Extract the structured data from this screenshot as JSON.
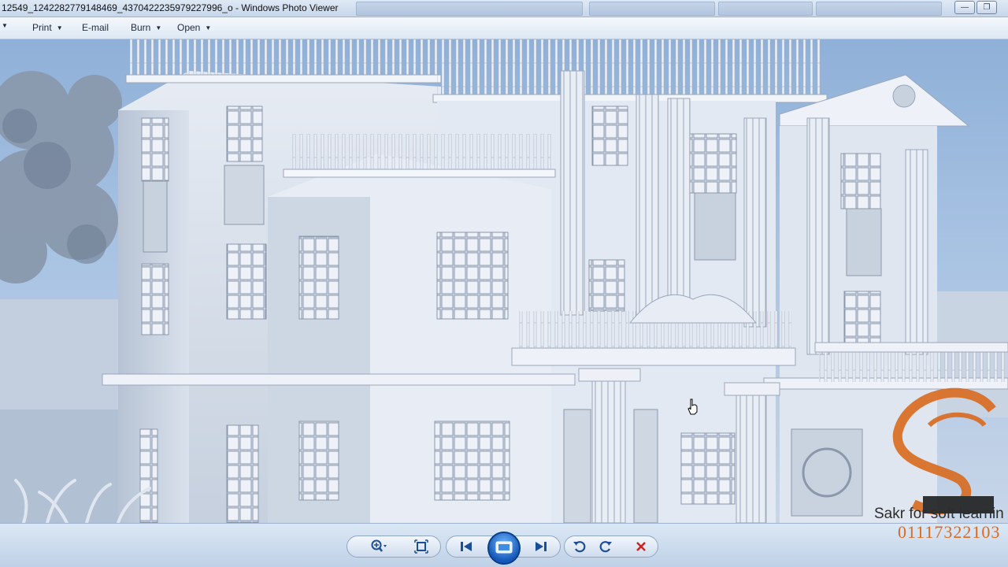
{
  "window": {
    "title": "12549_1242282779148469_4370422235979227996_o - Windows Photo Viewer",
    "controls": [
      "minimize",
      "restore"
    ]
  },
  "menu": {
    "items": [
      {
        "label": "Print",
        "has_dropdown": true
      },
      {
        "label": "E-mail",
        "has_dropdown": false
      },
      {
        "label": "Burn",
        "has_dropdown": true
      },
      {
        "label": "Open",
        "has_dropdown": true
      }
    ]
  },
  "photo": {
    "subject": "classical villa facade 3D render"
  },
  "controls": {
    "buttons": [
      "zoom-icon",
      "actual-size-icon",
      "previous-icon",
      "slideshow-icon",
      "next-icon",
      "rotate-counterclockwise-icon",
      "rotate-clockwise-icon",
      "delete-icon"
    ]
  },
  "watermark": {
    "brand": "Sakr for soft learnin",
    "phone": "01117322103"
  },
  "colors": {
    "accent": "#1457b8",
    "delete": "#d02020",
    "watermark_orange": "#d96a1e"
  }
}
